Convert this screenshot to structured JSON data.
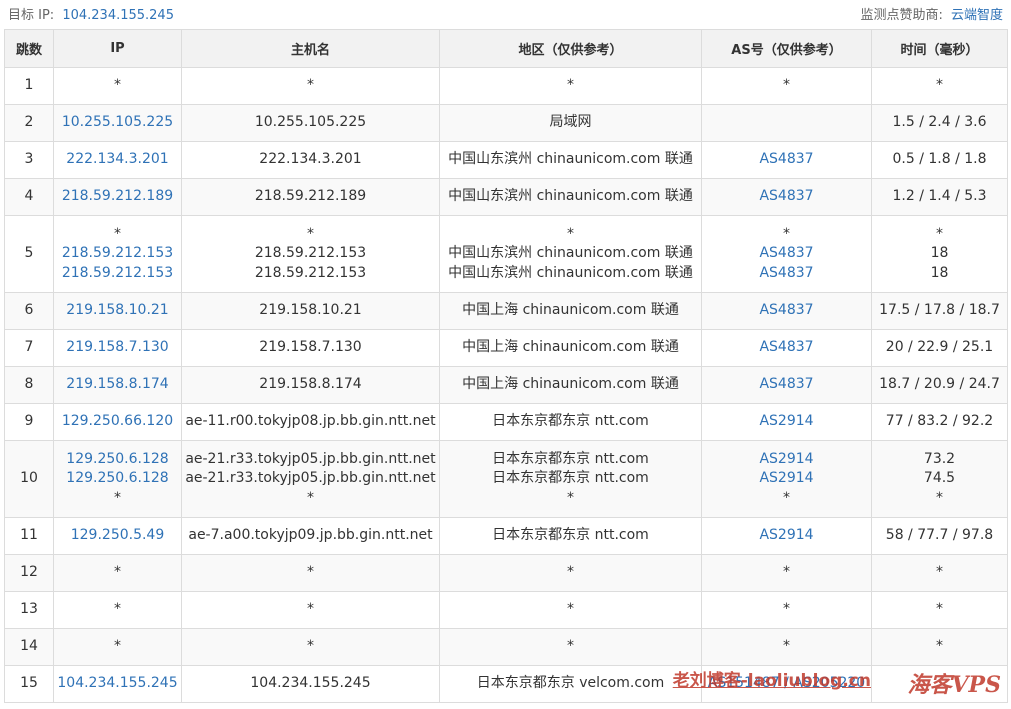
{
  "header": {
    "target_label": "目标 IP:",
    "target_ip": "104.234.155.245",
    "sponsor_label": "监测点赞助商:",
    "sponsor_name": "云端智度"
  },
  "columns": [
    "跳数",
    "IP",
    "主机名",
    "地区（仅供参考）",
    "AS号（仅供参考）",
    "时间（毫秒）"
  ],
  "rows": [
    {
      "hop": "1",
      "ip": [
        "*"
      ],
      "host": [
        "*"
      ],
      "region": [
        "*"
      ],
      "asn": [
        "*"
      ],
      "time": [
        "*"
      ]
    },
    {
      "hop": "2",
      "ip": [
        "10.255.105.225"
      ],
      "host": [
        "10.255.105.225"
      ],
      "region": [
        "局域网"
      ],
      "asn": [
        ""
      ],
      "time": [
        "1.5 / 2.4 / 3.6"
      ]
    },
    {
      "hop": "3",
      "ip": [
        "222.134.3.201"
      ],
      "host": [
        "222.134.3.201"
      ],
      "region": [
        "中国山东滨州 chinaunicom.com 联通"
      ],
      "asn": [
        "AS4837"
      ],
      "time": [
        "0.5 / 1.8 / 1.8"
      ]
    },
    {
      "hop": "4",
      "ip": [
        "218.59.212.189"
      ],
      "host": [
        "218.59.212.189"
      ],
      "region": [
        "中国山东滨州 chinaunicom.com 联通"
      ],
      "asn": [
        "AS4837"
      ],
      "time": [
        "1.2 / 1.4 / 5.3"
      ]
    },
    {
      "hop": "5",
      "ip": [
        "*",
        "218.59.212.153",
        "218.59.212.153"
      ],
      "host": [
        "*",
        "218.59.212.153",
        "218.59.212.153"
      ],
      "region": [
        "*",
        "中国山东滨州 chinaunicom.com 联通",
        "中国山东滨州 chinaunicom.com 联通"
      ],
      "asn": [
        "*",
        "AS4837",
        "AS4837"
      ],
      "time": [
        "*",
        "18",
        "18"
      ]
    },
    {
      "hop": "6",
      "ip": [
        "219.158.10.21"
      ],
      "host": [
        "219.158.10.21"
      ],
      "region": [
        "中国上海 chinaunicom.com 联通"
      ],
      "asn": [
        "AS4837"
      ],
      "time": [
        "17.5 / 17.8 / 18.7"
      ]
    },
    {
      "hop": "7",
      "ip": [
        "219.158.7.130"
      ],
      "host": [
        "219.158.7.130"
      ],
      "region": [
        "中国上海 chinaunicom.com 联通"
      ],
      "asn": [
        "AS4837"
      ],
      "time": [
        "20 / 22.9 / 25.1"
      ]
    },
    {
      "hop": "8",
      "ip": [
        "219.158.8.174"
      ],
      "host": [
        "219.158.8.174"
      ],
      "region": [
        "中国上海 chinaunicom.com 联通"
      ],
      "asn": [
        "AS4837"
      ],
      "time": [
        "18.7 / 20.9 / 24.7"
      ]
    },
    {
      "hop": "9",
      "ip": [
        "129.250.66.120"
      ],
      "host": [
        "ae-11.r00.tokyjp08.jp.bb.gin.ntt.net"
      ],
      "region": [
        "日本东京都东京 ntt.com"
      ],
      "asn": [
        "AS2914"
      ],
      "time": [
        "77 / 83.2 / 92.2"
      ]
    },
    {
      "hop": "10",
      "ip": [
        "129.250.6.128",
        "129.250.6.128",
        "*"
      ],
      "host": [
        "ae-21.r33.tokyjp05.jp.bb.gin.ntt.net",
        "ae-21.r33.tokyjp05.jp.bb.gin.ntt.net",
        "*"
      ],
      "region": [
        "日本东京都东京 ntt.com",
        "日本东京都东京 ntt.com",
        "*"
      ],
      "asn": [
        "AS2914",
        "AS2914",
        "*"
      ],
      "time": [
        "73.2",
        "74.5",
        "*"
      ]
    },
    {
      "hop": "11",
      "ip": [
        "129.250.5.49"
      ],
      "host": [
        "ae-7.a00.tokyjp09.jp.bb.gin.ntt.net"
      ],
      "region": [
        "日本东京都东京 ntt.com"
      ],
      "asn": [
        "AS2914"
      ],
      "time": [
        "58 / 77.7 / 97.8"
      ]
    },
    {
      "hop": "12",
      "ip": [
        "*"
      ],
      "host": [
        "*"
      ],
      "region": [
        "*"
      ],
      "asn": [
        "*"
      ],
      "time": [
        "*"
      ]
    },
    {
      "hop": "13",
      "ip": [
        "*"
      ],
      "host": [
        "*"
      ],
      "region": [
        "*"
      ],
      "asn": [
        "*"
      ],
      "time": [
        "*"
      ]
    },
    {
      "hop": "14",
      "ip": [
        "*"
      ],
      "host": [
        "*"
      ],
      "region": [
        "*"
      ],
      "asn": [
        "*"
      ],
      "time": [
        "*"
      ]
    },
    {
      "hop": "15",
      "ip": [
        "104.234.155.245"
      ],
      "host": [
        "104.234.155.245"
      ],
      "region": [
        "日本东京都东京 velcom.com"
      ],
      "asn": [
        "AS151487 / AS205220"
      ],
      "time": [
        ""
      ]
    }
  ],
  "watermark": {
    "site": "老刘博客-laoliublog.cn",
    "brand": "海客VPS"
  },
  "colors": {
    "link": "#2f72b6",
    "border": "#dcdcdc",
    "header_bg": "#f2f2f2",
    "watermark": "#c0392b"
  }
}
